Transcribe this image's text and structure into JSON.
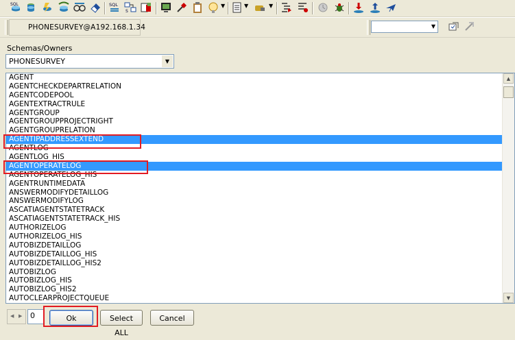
{
  "toolbar": {
    "icons": [
      "sql-db-icon",
      "db-stack-icon",
      "compile-icon",
      "sql-green-icon",
      "sql-explain-icon",
      "eraser-icon",
      "sql-icon",
      "query-builder-icon",
      "table-export-icon",
      "monitor-icon",
      "wand-icon",
      "clipboard-icon",
      "lightbulb-icon",
      "document-icon",
      "tools-icon",
      "indent-icon",
      "bug-icon",
      "disable-icon",
      "debug-icon",
      "import-icon",
      "export-icon",
      "plane-icon"
    ]
  },
  "connection": {
    "label": "PHONESURVEY@A192.168.1.34",
    "combo_value": ""
  },
  "schema": {
    "label": "Schemas/Owners",
    "selected": "PHONESURVEY"
  },
  "list": {
    "items": [
      "AGENT",
      "AGENTCHECKDEPARTRELATION",
      "AGENTCODEPOOL",
      "AGENTEXTRACTRULE",
      "AGENTGROUP",
      "AGENTGROUPPROJECTRIGHT",
      "AGENTGROUPRELATION",
      "AGENTIPADDRESSEXTEND",
      "AGENTLOG",
      "AGENTLOG_HIS",
      "AGENTOPERATELOG",
      "AGENTOPERATELOG_HIS",
      "AGENTRUNTIMEDATA",
      "ANSWERMODIFYDETAILLOG",
      "ANSWERMODIFYLOG",
      "ASCATIAGENTSTATETRACK",
      "ASCATIAGENTSTATETRACK_HIS",
      "AUTHORIZELOG",
      "AUTHORIZELOG_HIS",
      "AUTOBIZDETAILLOG",
      "AUTOBIZDETAILLOG_HIS",
      "AUTOBIZDETAILLOG_HIS2",
      "AUTOBIZLOG",
      "AUTOBIZLOG_HIS",
      "AUTOBIZLOG_HIS2",
      "AUTOCLEARPROJECTQUEUE"
    ],
    "selected_indices": [
      7,
      10
    ]
  },
  "bottom": {
    "page_number": "0",
    "ok_label": "Ok",
    "select_all_label": "Select ALL",
    "cancel_label": "Cancel"
  },
  "colors": {
    "selection": "#3399ff",
    "highlight_box": "#e21b22",
    "window_bg": "#ece9d8"
  }
}
